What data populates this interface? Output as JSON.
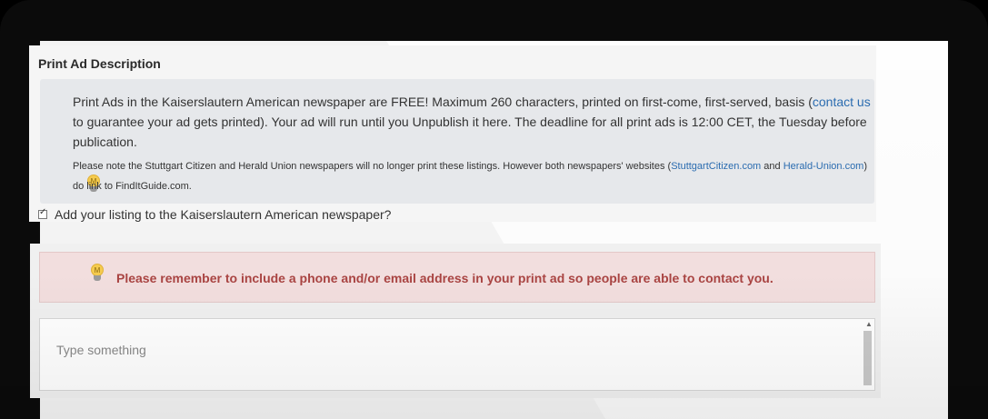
{
  "print_ad": {
    "title": "Print Ad Description",
    "info": {
      "text1": "Print Ads in the Kaiserslautern American newspaper are FREE! Maximum 260 characters, printed on first-come, first-served, basis (",
      "contact_link": "contact us",
      "text2": " to guarantee your ad gets printed). Your ad will run until you Unpublish it here. The deadline for all print ads is 12:00 CET, the Tuesday before publication.",
      "note1": "Please note the Stuttgart Citizen and Herald Union newspapers will no longer print these listings. However both newspapers' websites (",
      "link1": "StuttgartCitizen.com",
      "note2": " and ",
      "link2": "Herald-Union.com",
      "note3": ") do link to FindItGuide.com."
    },
    "checkbox": {
      "label": "Add your listing to the Kaiserslautern American newspaper?",
      "checked": true
    },
    "alert": {
      "text": "Please remember to include a phone and/or email address in your print ad so people are able to contact you."
    },
    "textarea": {
      "placeholder": "Type something",
      "value": ""
    },
    "icons": {
      "bulb": "lightbulb-icon",
      "bulb_letter": "M"
    },
    "colors": {
      "alert_bg": "#f2dede",
      "alert_text": "#a94442",
      "link": "#2b6cb0"
    }
  }
}
